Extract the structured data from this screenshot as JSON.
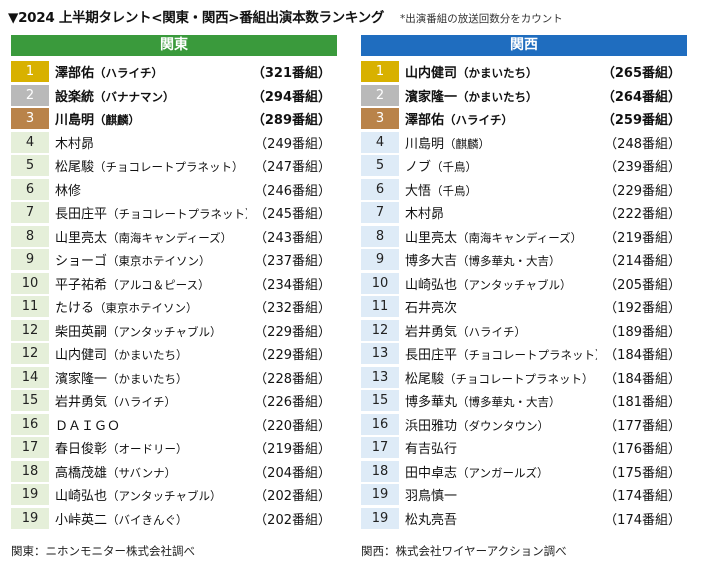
{
  "title": "▼2024 上半期タレント<関東・関西>番組出演本数ランキング",
  "note": "*出演番組の放送回数分をカウント",
  "kanto": {
    "header": "関東",
    "rows": [
      {
        "rank": "1",
        "name": "澤部佑",
        "group": "（ハライチ）",
        "count": "（321番組）"
      },
      {
        "rank": "2",
        "name": "設楽統",
        "group": "（バナナマン）",
        "count": "（294番組）"
      },
      {
        "rank": "3",
        "name": "川島明",
        "group": "（麒麟）",
        "count": "（289番組）"
      },
      {
        "rank": "4",
        "name": "木村昴",
        "group": "",
        "count": "（249番組）"
      },
      {
        "rank": "5",
        "name": "松尾駿",
        "group": "（チョコレートプラネット）",
        "count": "（247番組）"
      },
      {
        "rank": "6",
        "name": "林修",
        "group": "",
        "count": "（246番組）"
      },
      {
        "rank": "7",
        "name": "長田庄平",
        "group": "（チョコレートプラネット）",
        "count": "（245番組）"
      },
      {
        "rank": "8",
        "name": "山里亮太",
        "group": "（南海キャンディーズ）",
        "count": "（243番組）"
      },
      {
        "rank": "9",
        "name": "ショーゴ",
        "group": "（東京ホテイソン）",
        "count": "（237番組）"
      },
      {
        "rank": "10",
        "name": "平子祐希",
        "group": "（アルコ＆ピース）",
        "count": "（234番組）"
      },
      {
        "rank": "11",
        "name": "たける",
        "group": "（東京ホテイソン）",
        "count": "（232番組）"
      },
      {
        "rank": "12",
        "name": "柴田英嗣",
        "group": "（アンタッチャブル）",
        "count": "（229番組）"
      },
      {
        "rank": "12",
        "name": "山内健司",
        "group": "（かまいたち）",
        "count": "（229番組）"
      },
      {
        "rank": "14",
        "name": "濱家隆一",
        "group": "（かまいたち）",
        "count": "（228番組）"
      },
      {
        "rank": "15",
        "name": "岩井勇気",
        "group": "（ハライチ）",
        "count": "（226番組）"
      },
      {
        "rank": "16",
        "name": "ＤＡＩＧＯ",
        "group": "",
        "count": "（220番組）"
      },
      {
        "rank": "17",
        "name": "春日俊彰",
        "group": "（オードリー）",
        "count": "（219番組）"
      },
      {
        "rank": "18",
        "name": "高橋茂雄",
        "group": "（サバンナ）",
        "count": "（204番組）"
      },
      {
        "rank": "19",
        "name": "山崎弘也",
        "group": "（アンタッチャブル）",
        "count": "（202番組）"
      },
      {
        "rank": "19",
        "name": "小峠英二",
        "group": "（バイきんぐ）",
        "count": "（202番組）"
      }
    ],
    "source": "関東：ニホンモニター株式会社調べ"
  },
  "kansai": {
    "header": "関西",
    "rows": [
      {
        "rank": "1",
        "name": "山内健司",
        "group": "（かまいたち）",
        "count": "（265番組）"
      },
      {
        "rank": "2",
        "name": "濱家隆一",
        "group": "（かまいたち）",
        "count": "（264番組）"
      },
      {
        "rank": "3",
        "name": "澤部佑",
        "group": "（ハライチ）",
        "count": "（259番組）"
      },
      {
        "rank": "4",
        "name": "川島明",
        "group": "（麒麟）",
        "count": "（248番組）"
      },
      {
        "rank": "5",
        "name": "ノブ",
        "group": "（千鳥）",
        "count": "（239番組）"
      },
      {
        "rank": "6",
        "name": "大悟",
        "group": "（千鳥）",
        "count": "（229番組）"
      },
      {
        "rank": "7",
        "name": "木村昴",
        "group": "",
        "count": "（222番組）"
      },
      {
        "rank": "8",
        "name": "山里亮太",
        "group": "（南海キャンディーズ）",
        "count": "（219番組）"
      },
      {
        "rank": "9",
        "name": "博多大吉",
        "group": "（博多華丸・大吉）",
        "count": "（214番組）"
      },
      {
        "rank": "10",
        "name": "山崎弘也",
        "group": "（アンタッチャブル）",
        "count": "（205番組）"
      },
      {
        "rank": "11",
        "name": "石井亮次",
        "group": "",
        "count": "（192番組）"
      },
      {
        "rank": "12",
        "name": "岩井勇気",
        "group": "（ハライチ）",
        "count": "（189番組）"
      },
      {
        "rank": "13",
        "name": "長田庄平",
        "group": "（チョコレートプラネット）",
        "count": "（184番組）"
      },
      {
        "rank": "13",
        "name": "松尾駿",
        "group": "（チョコレートプラネット）",
        "count": "（184番組）"
      },
      {
        "rank": "15",
        "name": "博多華丸",
        "group": "（博多華丸・大吉）",
        "count": "（181番組）"
      },
      {
        "rank": "16",
        "name": "浜田雅功",
        "group": "（ダウンタウン）",
        "count": "（177番組）"
      },
      {
        "rank": "17",
        "name": "有吉弘行",
        "group": "",
        "count": "（176番組）"
      },
      {
        "rank": "18",
        "name": "田中卓志",
        "group": "（アンガールズ）",
        "count": "（175番組）"
      },
      {
        "rank": "19",
        "name": "羽鳥慎一",
        "group": "",
        "count": "（174番組）"
      },
      {
        "rank": "19",
        "name": "松丸亮吾",
        "group": "",
        "count": "（174番組）"
      }
    ],
    "source": "関西：株式会社ワイヤーアクション調べ"
  },
  "colors": {
    "kanto_header": "#3a9a3c",
    "kansai_header": "#1f6dbf",
    "gold": "#d8b100",
    "silver": "#b9b9b9",
    "bronze": "#b9834a"
  }
}
